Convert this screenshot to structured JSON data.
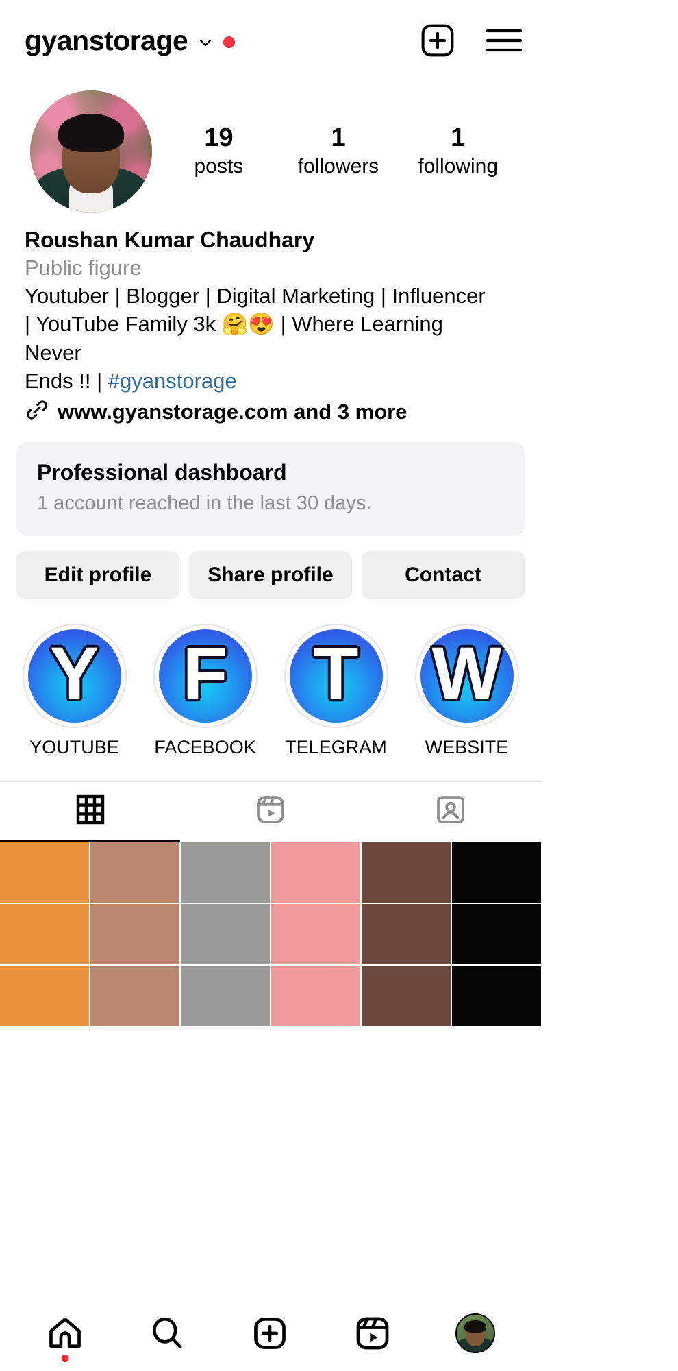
{
  "header": {
    "username": "gyanstorage",
    "chevron_icon": "chevron-down-icon",
    "badge_dot_color": "#ff3040",
    "add_icon": "plus-square-icon",
    "menu_icon": "hamburger-menu-icon"
  },
  "profile": {
    "avatar_alt": "profile-photo",
    "stats": [
      {
        "value": "19",
        "label": "posts"
      },
      {
        "value": "1",
        "label": "followers"
      },
      {
        "value": "1",
        "label": "following"
      }
    ],
    "full_name": "Roushan Kumar Chaudhary",
    "category": "Public figure",
    "bio_line_1": "Youtuber | Blogger | Digital Marketing | Influencer",
    "bio_line_2": "| YouTube Family 3k 🤗😍 | Where Learning Never",
    "bio_line_3_text": "Ends !! | ",
    "bio_hashtag": "#gyanstorage",
    "hashtag_color": "#2e6a9e",
    "link_icon": "link-chain-icon",
    "link_text": "www.gyanstorage.com and 3 more"
  },
  "dashboard": {
    "title": "Professional dashboard",
    "subtitle": "1 account reached in the last 30 days."
  },
  "actions": [
    {
      "label": "Edit profile",
      "name": "edit-profile-button"
    },
    {
      "label": "Share profile",
      "name": "share-profile-button"
    },
    {
      "label": "Contact",
      "name": "contact-button"
    }
  ],
  "highlights": [
    {
      "letter": "Y",
      "label": "YOUTUBE"
    },
    {
      "letter": "F",
      "label": "FACEBOOK"
    },
    {
      "letter": "T",
      "label": "TELEGRAM"
    },
    {
      "letter": "W",
      "label": "WEBSITE"
    }
  ],
  "tabs": [
    {
      "icon": "grid-icon",
      "name": "tab-grid",
      "active": true
    },
    {
      "icon": "reels-icon",
      "name": "tab-reels",
      "active": false
    },
    {
      "icon": "tagged-person-icon",
      "name": "tab-tagged",
      "active": false
    }
  ],
  "grid_cells": [
    "#e8943c",
    "#b98670",
    "#9a9a96",
    "#ef9a9c",
    "#6d483f",
    "#050505",
    "#e8943c",
    "#b98670",
    "#9a9a96",
    "#ef9a9c",
    "#6d483f",
    "#050505",
    "#e8943c",
    "#b98670",
    "#9a9a96",
    "#ef9a9c",
    "#6d483f",
    "#050505",
    "#dd9bc2",
    "#1f4349",
    "#ca1a26",
    "#e8795f",
    "#222b2e",
    "#050505",
    "#dd9bc2",
    "#1f4349",
    "#ca1a26",
    "#e8795f",
    "#222b2e",
    "#050505",
    "#8c3549",
    "#14333a",
    "#7c6066",
    "#e14f33",
    "#2b2326",
    "#050505"
  ],
  "bottom_nav": [
    {
      "icon": "home-icon",
      "name": "nav-home",
      "badge": true
    },
    {
      "icon": "search-icon",
      "name": "nav-search",
      "badge": false
    },
    {
      "icon": "create-plus-icon",
      "name": "nav-create",
      "badge": false
    },
    {
      "icon": "reels-icon",
      "name": "nav-reels",
      "badge": false
    },
    {
      "icon": "profile-avatar",
      "name": "nav-profile",
      "badge": false
    }
  ]
}
